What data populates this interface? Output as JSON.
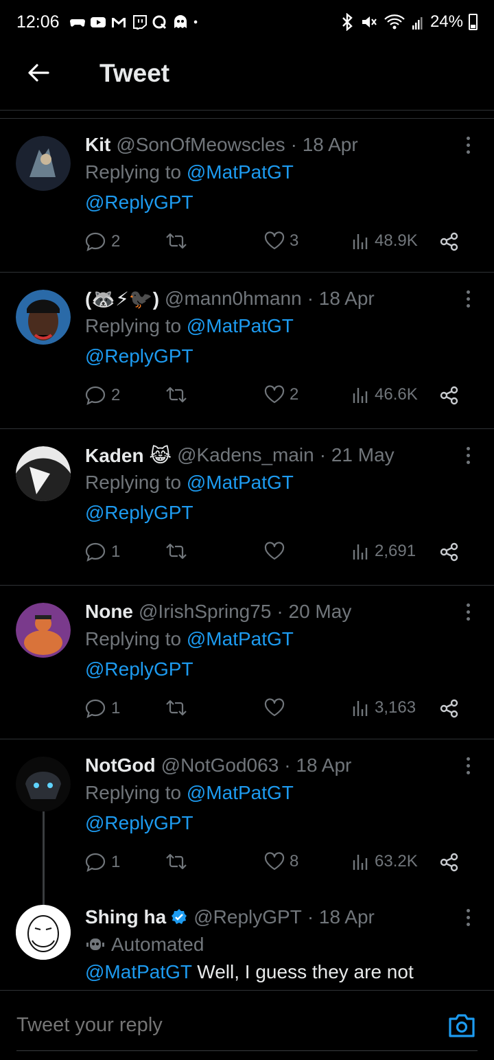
{
  "status_bar": {
    "time": "12:06",
    "battery": "24%",
    "notification_icons": [
      "gamepad-icon",
      "youtube-icon",
      "gmail-icon",
      "twitch-icon",
      "quora-icon",
      "reddit-icon",
      "dot-icon"
    ],
    "system_icons": [
      "bluetooth-icon",
      "mute-icon",
      "wifi-icon",
      "signal-icon",
      "battery-icon"
    ]
  },
  "header": {
    "title": "Tweet",
    "back_icon": "arrow-left-icon"
  },
  "tweets": [
    {
      "name": "Kit",
      "handle": "@SonOfMeowscles",
      "date": "· 18 Apr",
      "replying_prefix": "Replying to ",
      "replying_to": "@MatPatGT",
      "text": "@ReplyGPT",
      "replies": "2",
      "retweets": "",
      "likes": "3",
      "views": "48.9K"
    },
    {
      "name": "(🦝⚡🐦‍⬛)",
      "handle": "@mann0hmann",
      "date": "· 18 Apr",
      "replying_prefix": "Replying to ",
      "replying_to": "@MatPatGT",
      "text": "@ReplyGPT",
      "replies": "2",
      "retweets": "",
      "likes": "2",
      "views": "46.6K"
    },
    {
      "name": "Kaden 😹",
      "handle": "@Kadens_main",
      "date": "· 21 May",
      "replying_prefix": "Replying to ",
      "replying_to": "@MatPatGT",
      "text": "@ReplyGPT",
      "replies": "1",
      "retweets": "",
      "likes": "",
      "views": "2,691"
    },
    {
      "name": "None",
      "handle": "@IrishSpring75",
      "date": "· 20 May",
      "replying_prefix": "Replying to ",
      "replying_to": "@MatPatGT",
      "text": "@ReplyGPT",
      "replies": "1",
      "retweets": "",
      "likes": "",
      "views": "3,163"
    },
    {
      "name": "NotGod",
      "handle": "@NotGod063",
      "date": "· 18 Apr",
      "replying_prefix": "Replying to ",
      "replying_to": "@MatPatGT",
      "text": "@ReplyGPT",
      "replies": "1",
      "retweets": "",
      "likes": "8",
      "views": "63.2K"
    }
  ],
  "last_tweet": {
    "name": "Shing ha",
    "handle": "@ReplyGPT",
    "date": "· 18 Apr",
    "verified_icon": "verified-badge-icon",
    "automated_label": "Automated",
    "mention": "@MatPatGT",
    "text": " Well, I guess they are not"
  },
  "reply_bar": {
    "placeholder": "Tweet your reply",
    "camera_icon": "camera-icon"
  },
  "colors": {
    "accent": "#1d9bf0",
    "muted": "#71767b",
    "text": "#e7e9ea",
    "background": "#000000"
  }
}
